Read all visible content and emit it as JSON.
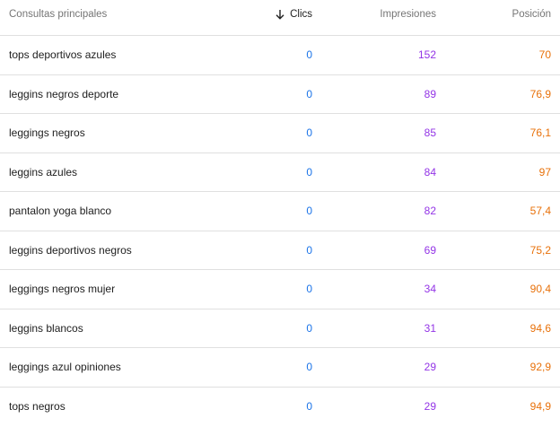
{
  "table": {
    "headers": {
      "query": "Consultas principales",
      "clicks": "Clics",
      "impressions": "Impresiones",
      "position": "Posición"
    },
    "sort": {
      "column": "clicks",
      "direction": "descending",
      "icon": "arrow-down-icon"
    },
    "rows": [
      {
        "query": "tops deportivos azules",
        "clicks": "0",
        "impressions": "152",
        "position": "70"
      },
      {
        "query": "leggins negros deporte",
        "clicks": "0",
        "impressions": "89",
        "position": "76,9"
      },
      {
        "query": "leggings negros",
        "clicks": "0",
        "impressions": "85",
        "position": "76,1"
      },
      {
        "query": "leggins azules",
        "clicks": "0",
        "impressions": "84",
        "position": "97"
      },
      {
        "query": "pantalon yoga blanco",
        "clicks": "0",
        "impressions": "82",
        "position": "57,4"
      },
      {
        "query": "leggins deportivos negros",
        "clicks": "0",
        "impressions": "69",
        "position": "75,2"
      },
      {
        "query": "leggings negros mujer",
        "clicks": "0",
        "impressions": "34",
        "position": "90,4"
      },
      {
        "query": "leggins blancos",
        "clicks": "0",
        "impressions": "31",
        "position": "94,6"
      },
      {
        "query": "leggings azul opiniones",
        "clicks": "0",
        "impressions": "29",
        "position": "92,9"
      },
      {
        "query": "tops negros",
        "clicks": "0",
        "impressions": "29",
        "position": "94,9"
      }
    ]
  },
  "colors": {
    "clicks": "#1a73e8",
    "impressions": "#9334e6",
    "position": "#e8710a",
    "text": "#212121",
    "header_text": "#757575",
    "divider": "#e0e0e0"
  }
}
